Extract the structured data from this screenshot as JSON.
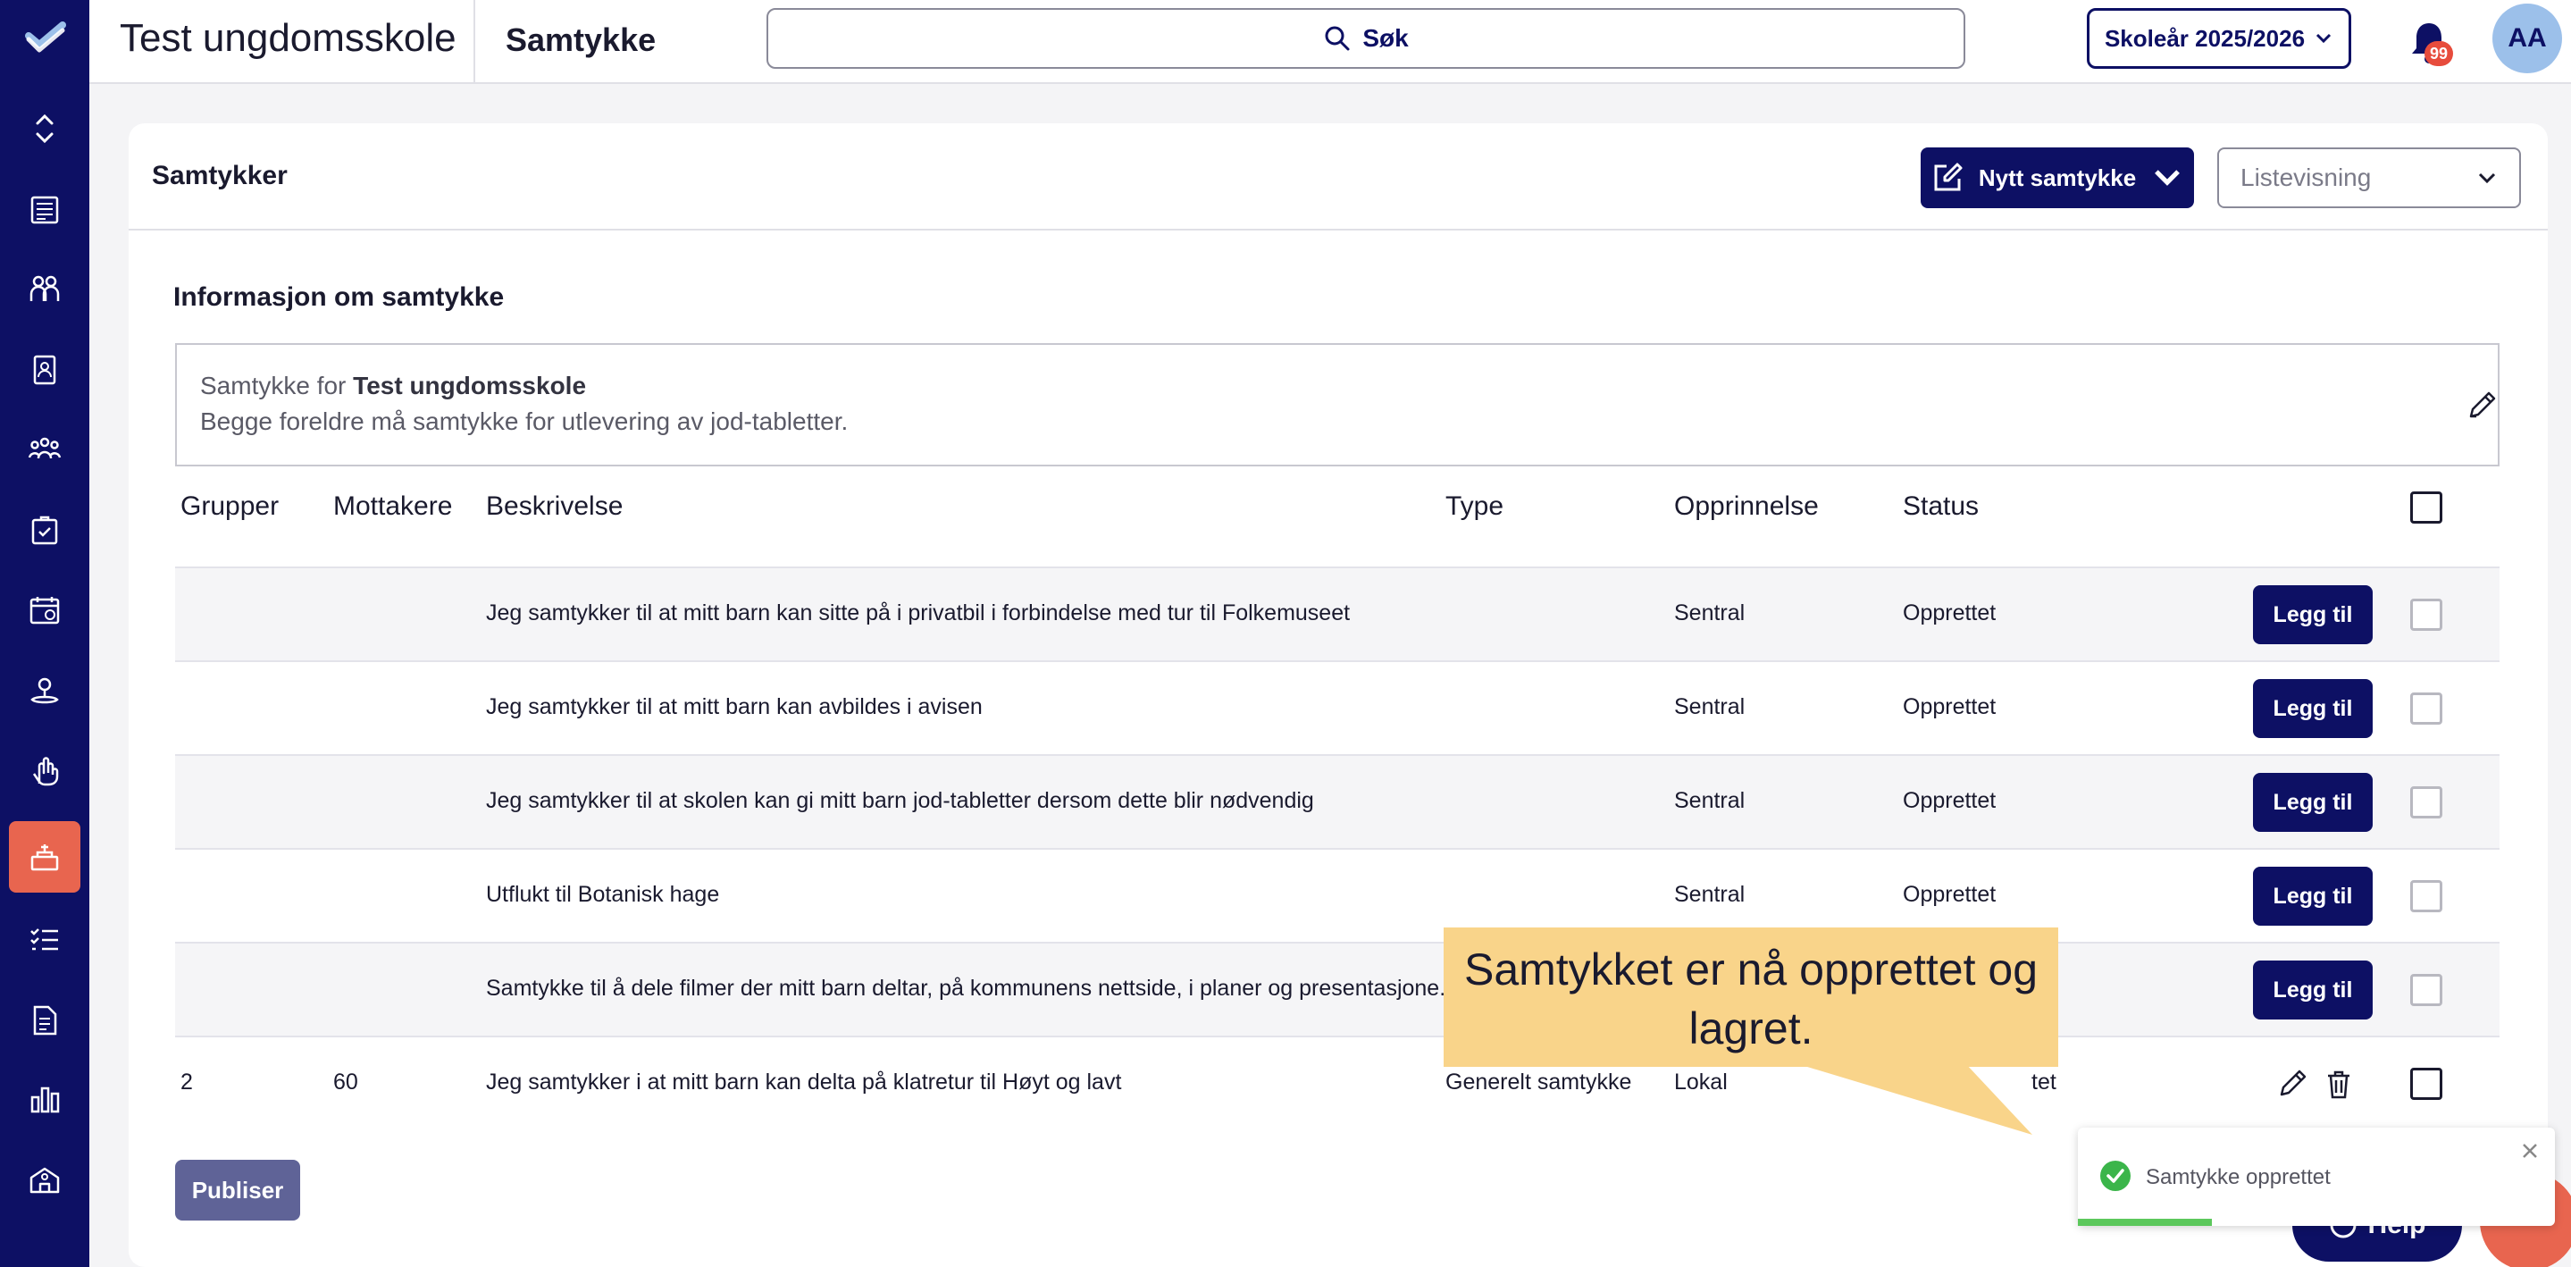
{
  "app": {
    "school_name": "Test ungdomsskole",
    "page_name": "Samtykke",
    "search_label": "Søk",
    "school_year": "Skoleår 2025/2026",
    "notification_count": "99",
    "user_initials": "AA"
  },
  "sidebar": {
    "items": [
      {
        "icon": "collapse-icon"
      },
      {
        "icon": "news-icon"
      },
      {
        "icon": "users-icon"
      },
      {
        "icon": "id-badge-icon"
      },
      {
        "icon": "groups-icon"
      },
      {
        "icon": "puzzle-icon"
      },
      {
        "icon": "calendar-clock-icon"
      },
      {
        "icon": "person-pin-icon"
      },
      {
        "icon": "hand-icon"
      },
      {
        "icon": "consent-icon",
        "active": true
      },
      {
        "icon": "checklist-icon"
      },
      {
        "icon": "document-icon"
      },
      {
        "icon": "bar-chart-icon"
      },
      {
        "icon": "school-icon"
      }
    ]
  },
  "card": {
    "title": "Samtykker",
    "new_button": "Nytt samtykke",
    "view_select": "Listevisning"
  },
  "info": {
    "title": "Informasjon om samtykke",
    "prefix": "Samtykke for",
    "school": "Test ungdomsskole",
    "description": "Begge foreldre må samtykke for utlevering av jod-tabletter."
  },
  "table": {
    "headers": {
      "groups": "Grupper",
      "recipients": "Mottakere",
      "description": "Beskrivelse",
      "type": "Type",
      "origin": "Opprinnelse",
      "status": "Status"
    },
    "add_label": "Legg til",
    "rows": [
      {
        "groups": "",
        "recipients": "",
        "description": "Jeg samtykker til at mitt barn kan sitte på i privatbil i forbindelse med tur til Folkemuseet",
        "type": "",
        "origin": "Sentral",
        "status": "Opprettet"
      },
      {
        "groups": "",
        "recipients": "",
        "description": "Jeg samtykker til at mitt barn kan avbildes i avisen",
        "type": "",
        "origin": "Sentral",
        "status": "Opprettet"
      },
      {
        "groups": "",
        "recipients": "",
        "description": "Jeg samtykker til at skolen kan gi mitt barn jod-tabletter dersom dette blir nødvendig",
        "type": "",
        "origin": "Sentral",
        "status": "Opprettet"
      },
      {
        "groups": "",
        "recipients": "",
        "description": "Utflukt til Botanisk hage",
        "type": "",
        "origin": "Sentral",
        "status": "Opprettet"
      },
      {
        "groups": "",
        "recipients": "",
        "description": "Samtykke til å dele filmer der mitt barn deltar, på kommunens nettside, i planer og presentasjone...",
        "type": "",
        "origin": "",
        "status": ""
      },
      {
        "groups": "2",
        "recipients": "60",
        "description": "Jeg samtykker i at mitt barn kan delta på klatretur til Høyt og lavt",
        "type": "Generelt samtykke",
        "origin": "Lokal",
        "status": "tet"
      }
    ]
  },
  "publish_button": "Publiser",
  "callout": "Samtykket er nå opprettet og lagret.",
  "toast": {
    "message": "Samtykke opprettet",
    "progress": 0.28
  },
  "help_button": "Help",
  "colors": {
    "navy": "#0d1064",
    "accent": "#e8654f",
    "callout": "#f9d48a",
    "success": "#5cc85c"
  }
}
